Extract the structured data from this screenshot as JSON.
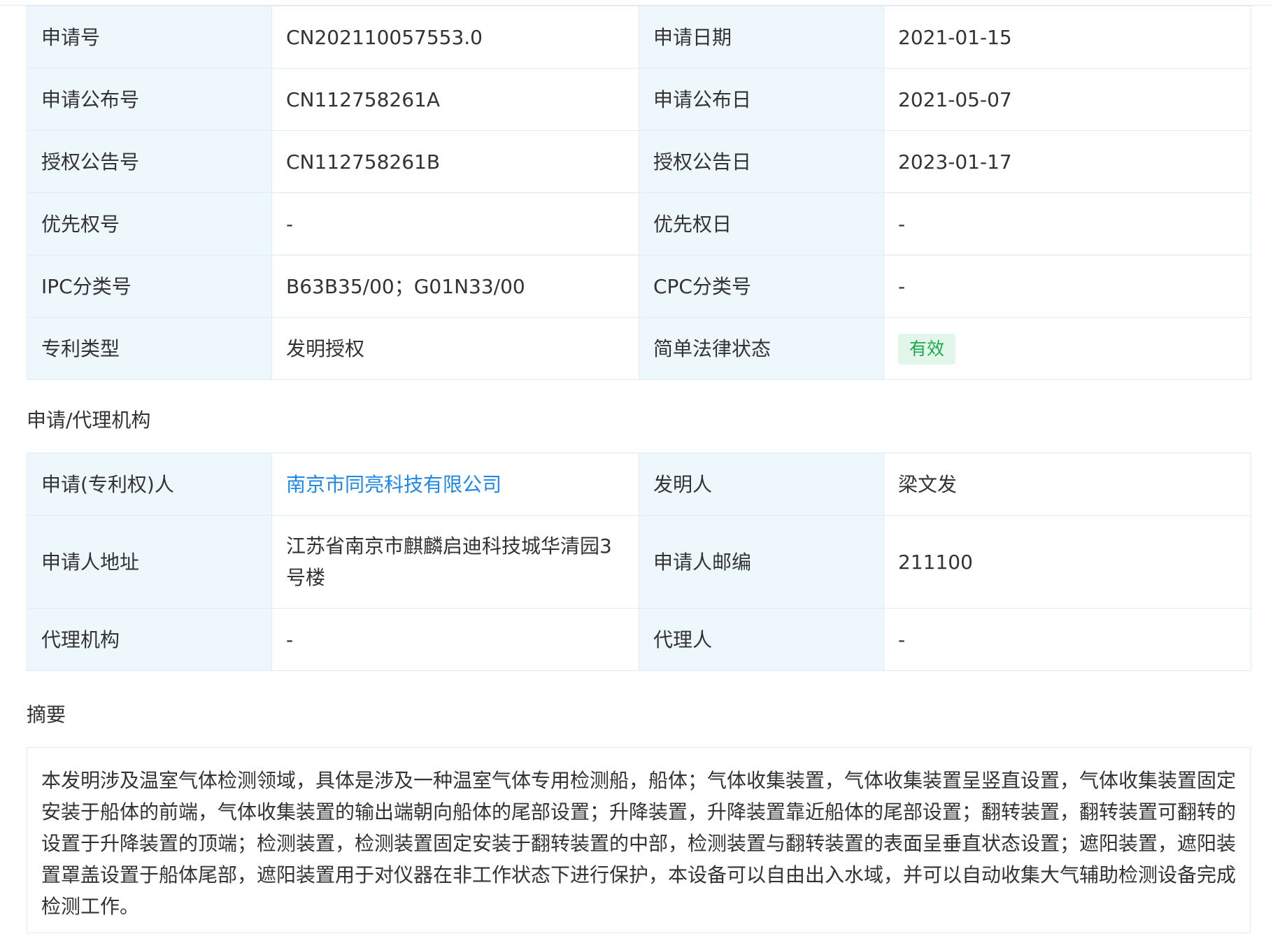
{
  "basic_info": {
    "rows": [
      {
        "l1": "申请号",
        "v1": "CN202110057553.0",
        "l2": "申请日期",
        "v2": "2021-01-15"
      },
      {
        "l1": "申请公布号",
        "v1": "CN112758261A",
        "l2": "申请公布日",
        "v2": "2021-05-07"
      },
      {
        "l1": "授权公告号",
        "v1": "CN112758261B",
        "l2": "授权公告日",
        "v2": "2023-01-17"
      },
      {
        "l1": "优先权号",
        "v1": "-",
        "l2": "优先权日",
        "v2": "-"
      },
      {
        "l1": "IPC分类号",
        "v1": "B63B35/00；G01N33/00",
        "l2": "CPC分类号",
        "v2": "-"
      },
      {
        "l1": "专利类型",
        "v1": "发明授权",
        "l2": "简单法律状态",
        "v2": "有效"
      }
    ]
  },
  "agency": {
    "title": "申请/代理机构",
    "rows": [
      {
        "l1": "申请(专利权)人",
        "v1": "南京市同亮科技有限公司",
        "l2": "发明人",
        "v2": "梁文发"
      },
      {
        "l1": "申请人地址",
        "v1": "江苏省南京市麒麟启迪科技城华清园3号楼",
        "l2": "申请人邮编",
        "v2": "211100"
      },
      {
        "l1": "代理机构",
        "v1": "-",
        "l2": "代理人",
        "v2": "-"
      }
    ]
  },
  "abstract": {
    "title": "摘要",
    "text": "本发明涉及温室气体检测领域，具体是涉及一种温室气体专用检测船，船体；气体收集装置，气体收集装置呈竖直设置，气体收集装置固定安装于船体的前端，气体收集装置的输出端朝向船体的尾部设置；升降装置，升降装置靠近船体的尾部设置；翻转装置，翻转装置可翻转的设置于升降装置的顶端；检测装置，检测装置固定安装于翻转装置的中部，检测装置与翻转装置的表面呈垂直状态设置；遮阳装置，遮阳装置罩盖设置于船体尾部，遮阳装置用于对仪器在非工作状态下进行保护，本设备可以自由出入水域，并可以自动收集大气辅助检测设备完成检测工作。"
  },
  "colors": {
    "label_bg": "#eef7fc",
    "border": "#dcedf6",
    "link": "#1f87e8",
    "status_green": "#1bab4f",
    "status_bg": "#e3f6ea"
  }
}
